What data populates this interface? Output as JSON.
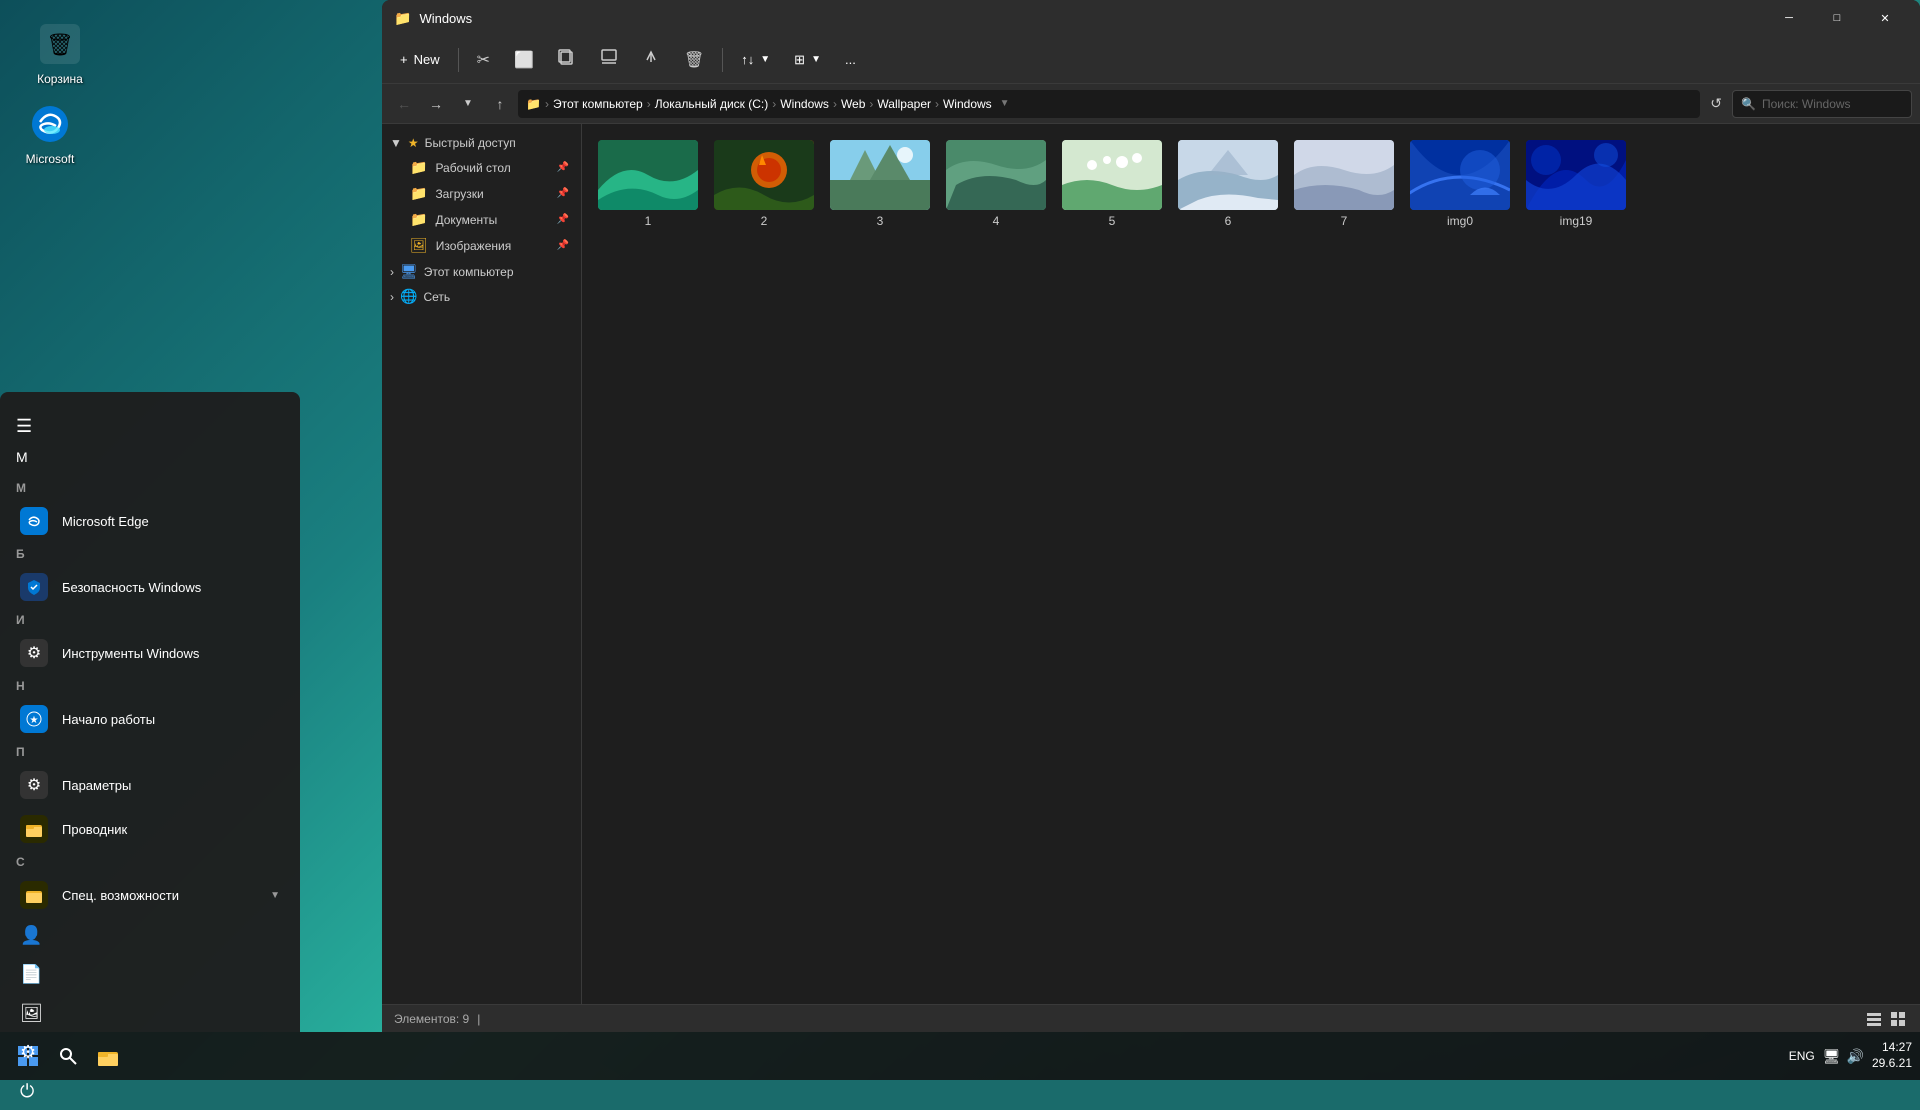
{
  "desktop": {
    "icon_recycle": "Корзина",
    "icon_edge": "Microsoft Edge"
  },
  "taskbar": {
    "lang": "ENG",
    "time": "14:27",
    "date": "29.6.21"
  },
  "start_menu": {
    "user_initial": "M",
    "sections": [
      {
        "letter": "M",
        "items": [
          {
            "label": "Microsoft Edge",
            "icon": "🌐",
            "icon_color": "#0078d4"
          }
        ]
      },
      {
        "letter": "Б",
        "items": [
          {
            "label": "Безопасность Windows",
            "icon": "🛡",
            "icon_color": "#0078d4"
          }
        ]
      },
      {
        "letter": "И",
        "items": [
          {
            "label": "Инструменты Windows",
            "icon": "⚙",
            "icon_color": "#666"
          }
        ]
      },
      {
        "letter": "Н",
        "items": [
          {
            "label": "Начало работы",
            "icon": "★",
            "icon_color": "#0078d4"
          }
        ]
      },
      {
        "letter": "П",
        "items": [
          {
            "label": "Параметры",
            "icon": "⚙",
            "icon_color": "#666"
          },
          {
            "label": "Проводник",
            "icon": "📁",
            "icon_color": "#f0b429"
          }
        ]
      },
      {
        "letter": "С",
        "items": [
          {
            "label": "Спец. возможности",
            "icon": "📁",
            "icon_color": "#f0b429",
            "expand": true
          }
        ]
      }
    ],
    "bottom_items": [
      {
        "label": "",
        "icon": "👤"
      },
      {
        "label": "",
        "icon": "📄"
      },
      {
        "label": "",
        "icon": "🖼"
      },
      {
        "label": "",
        "icon": "⚙"
      },
      {
        "label": "",
        "icon": "⏻"
      }
    ]
  },
  "explorer": {
    "title": "Windows",
    "toolbar": {
      "new_label": "New",
      "cut_icon": "✂",
      "copy_icon": "⬜",
      "paste_icon": "📋",
      "rename_icon": "✏",
      "share_icon": "↑",
      "delete_icon": "🗑",
      "sort_label": "↑↓",
      "view_label": "⊞",
      "more_label": "..."
    },
    "breadcrumb": {
      "parts": [
        "Этот компьютер",
        "Локальный диск (C:)",
        "Windows",
        "Web",
        "Wallpaper",
        "Windows"
      ]
    },
    "search_placeholder": "Поиск: Windows",
    "sidebar": {
      "quick_access_label": "Быстрый доступ",
      "items": [
        {
          "label": "Рабочий стол",
          "pinned": true
        },
        {
          "label": "Загрузки",
          "pinned": true
        },
        {
          "label": "Документы",
          "pinned": true
        },
        {
          "label": "Изображения",
          "pinned": true
        }
      ],
      "this_pc_label": "Этот компьютер",
      "network_label": "Сеть"
    },
    "files": [
      {
        "name": "1",
        "thumb_class": "thumb-1"
      },
      {
        "name": "2",
        "thumb_class": "thumb-2"
      },
      {
        "name": "3",
        "thumb_class": "thumb-3"
      },
      {
        "name": "4",
        "thumb_class": "thumb-4"
      },
      {
        "name": "5",
        "thumb_class": "thumb-5"
      },
      {
        "name": "6",
        "thumb_class": "thumb-6"
      },
      {
        "name": "7",
        "thumb_class": "thumb-7"
      },
      {
        "name": "img0",
        "thumb_class": "thumb-img0"
      },
      {
        "name": "img19",
        "thumb_class": "thumb-img19"
      }
    ],
    "status": "Элементов: 9",
    "status_cursor": "|"
  }
}
